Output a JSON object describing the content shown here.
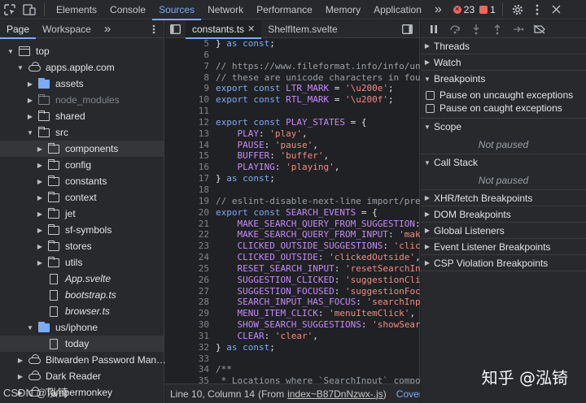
{
  "toolbar": {
    "tabs": [
      "Elements",
      "Console",
      "Sources",
      "Network",
      "Performance",
      "Memory",
      "Application"
    ],
    "active_tab": "Sources",
    "more": "»",
    "error_count": "23",
    "warning_count": "1"
  },
  "navigator": {
    "tabs": [
      "Page",
      "Workspace"
    ],
    "more": "»",
    "items": [
      {
        "label": "top",
        "depth": 0,
        "arrow": "▼",
        "icon": "frame"
      },
      {
        "label": "apps.apple.com",
        "depth": 1,
        "arrow": "▼",
        "icon": "cloud"
      },
      {
        "label": "assets",
        "depth": 2,
        "arrow": "▶",
        "icon": "folder-blue"
      },
      {
        "label": "node_modules",
        "depth": 2,
        "arrow": "▶",
        "icon": "folder-dim"
      },
      {
        "label": "shared",
        "depth": 2,
        "arrow": "▶",
        "icon": "folder"
      },
      {
        "label": "src",
        "depth": 2,
        "arrow": "▼",
        "icon": "folder"
      },
      {
        "label": "components",
        "depth": 3,
        "arrow": "▶",
        "icon": "folder",
        "selected": true
      },
      {
        "label": "config",
        "depth": 3,
        "arrow": "▶",
        "icon": "folder"
      },
      {
        "label": "constants",
        "depth": 3,
        "arrow": "▶",
        "icon": "folder"
      },
      {
        "label": "context",
        "depth": 3,
        "arrow": "▶",
        "icon": "folder"
      },
      {
        "label": "jet",
        "depth": 3,
        "arrow": "▶",
        "icon": "folder"
      },
      {
        "label": "sf-symbols",
        "depth": 3,
        "arrow": "▶",
        "icon": "folder"
      },
      {
        "label": "stores",
        "depth": 3,
        "arrow": "▶",
        "icon": "folder"
      },
      {
        "label": "utils",
        "depth": 3,
        "arrow": "▶",
        "icon": "folder"
      },
      {
        "label": "App.svelte",
        "depth": 3,
        "arrow": "",
        "icon": "file",
        "italic": true
      },
      {
        "label": "bootstrap.ts",
        "depth": 3,
        "arrow": "",
        "icon": "file",
        "italic": true
      },
      {
        "label": "browser.ts",
        "depth": 3,
        "arrow": "",
        "icon": "file",
        "italic": true
      },
      {
        "label": "us/iphone",
        "depth": 2,
        "arrow": "▼",
        "icon": "folder-blue"
      },
      {
        "label": "today",
        "depth": 3,
        "arrow": "",
        "icon": "file",
        "selected": true
      },
      {
        "label": "Bitwarden Password Man…",
        "depth": 1,
        "arrow": "▶",
        "icon": "cloud"
      },
      {
        "label": "Dark Reader",
        "depth": 1,
        "arrow": "▶",
        "icon": "cloud"
      },
      {
        "label": "Tampermonkey",
        "depth": 1,
        "arrow": "▶",
        "icon": "cloud"
      }
    ]
  },
  "editor": {
    "tabs": [
      "constants.ts",
      "ShelfItem.svelte"
    ],
    "active_tab": "constants.ts",
    "lines": [
      {
        "n": "5",
        "t": "} as const;"
      },
      {
        "n": "6",
        "t": ""
      },
      {
        "n": "7",
        "t": "// https://www.fileformat.info/info/unicode"
      },
      {
        "n": "8",
        "t": "// these are unicode characters in four hex"
      },
      {
        "n": "9",
        "t": "export const LTR_MARK = '\\u200e';"
      },
      {
        "n": "10",
        "t": "export const RTL_MARK = '\\u200f';"
      },
      {
        "n": "11",
        "t": ""
      },
      {
        "n": "12",
        "t": "export const PLAY_STATES = {"
      },
      {
        "n": "13",
        "t": "    PLAY: 'play',"
      },
      {
        "n": "14",
        "t": "    PAUSE: 'pause',"
      },
      {
        "n": "15",
        "t": "    BUFFER: 'buffer',"
      },
      {
        "n": "16",
        "t": "    PLAYING: 'playing',"
      },
      {
        "n": "17",
        "t": "} as const;"
      },
      {
        "n": "18",
        "t": ""
      },
      {
        "n": "19",
        "t": "// eslint-disable-next-line import/prefer-de"
      },
      {
        "n": "20",
        "t": "export const SEARCH_EVENTS = {"
      },
      {
        "n": "21",
        "t": "    MAKE_SEARCH_QUERY_FROM_SUGGESTION: 'make"
      },
      {
        "n": "22",
        "t": "    MAKE_SEARCH_QUERY_FROM_INPUT: 'makeSear"
      },
      {
        "n": "23",
        "t": "    CLICKED_OUTSIDE_SUGGESTIONS: 'clickedOu"
      },
      {
        "n": "24",
        "t": "    CLICKED_OUTSIDE: 'clickedOutside',"
      },
      {
        "n": "25",
        "t": "    RESET_SEARCH_INPUT: 'resetSearchInput',"
      },
      {
        "n": "26",
        "t": "    SUGGESTION_CLICKED: 'suggestionClicked'"
      },
      {
        "n": "27",
        "t": "    SUGGESTION_FOCUSED: 'suggestionFocused'"
      },
      {
        "n": "28",
        "t": "    SEARCH_INPUT_HAS_FOCUS: 'searchInputHas"
      },
      {
        "n": "29",
        "t": "    MENU_ITEM_CLICK: 'menuItemClick',"
      },
      {
        "n": "30",
        "t": "    SHOW_SEARCH_SUGGESTIONS: 'showSearchSugg"
      },
      {
        "n": "31",
        "t": "    CLEAR: 'clear',"
      },
      {
        "n": "32",
        "t": "} as const;"
      },
      {
        "n": "33",
        "t": ""
      },
      {
        "n": "34",
        "t": "/**"
      },
      {
        "n": "35",
        "t": " * Locations where `SearchInput` component"
      }
    ],
    "status": {
      "position": "Line 10, Column 14",
      "from_prefix": "(From",
      "from_link": "index~B87DnNzwx-.js",
      "from_suffix": ")",
      "coverage": "Covera"
    }
  },
  "debugger": {
    "sections": {
      "threads": "Threads",
      "watch": "Watch",
      "breakpoints": "Breakpoints",
      "pause_uncaught": "Pause on uncaught exceptions",
      "pause_caught": "Pause on caught exceptions",
      "scope": "Scope",
      "scope_status": "Not paused",
      "call_stack": "Call Stack",
      "call_stack_status": "Not paused",
      "xhr": "XHR/fetch Breakpoints",
      "dom": "DOM Breakpoints",
      "global": "Global Listeners",
      "event": "Event Listener Breakpoints",
      "csp": "CSP Violation Breakpoints"
    }
  },
  "watermark": {
    "right": "知乎 @泓锜",
    "left": "CSDN @泓锜"
  },
  "colors": {
    "keyword": "#7cacf8",
    "string": "#f28b82",
    "comment": "#9aa0a6",
    "identifier": "#c58af9",
    "accent": "#7cacf8"
  }
}
